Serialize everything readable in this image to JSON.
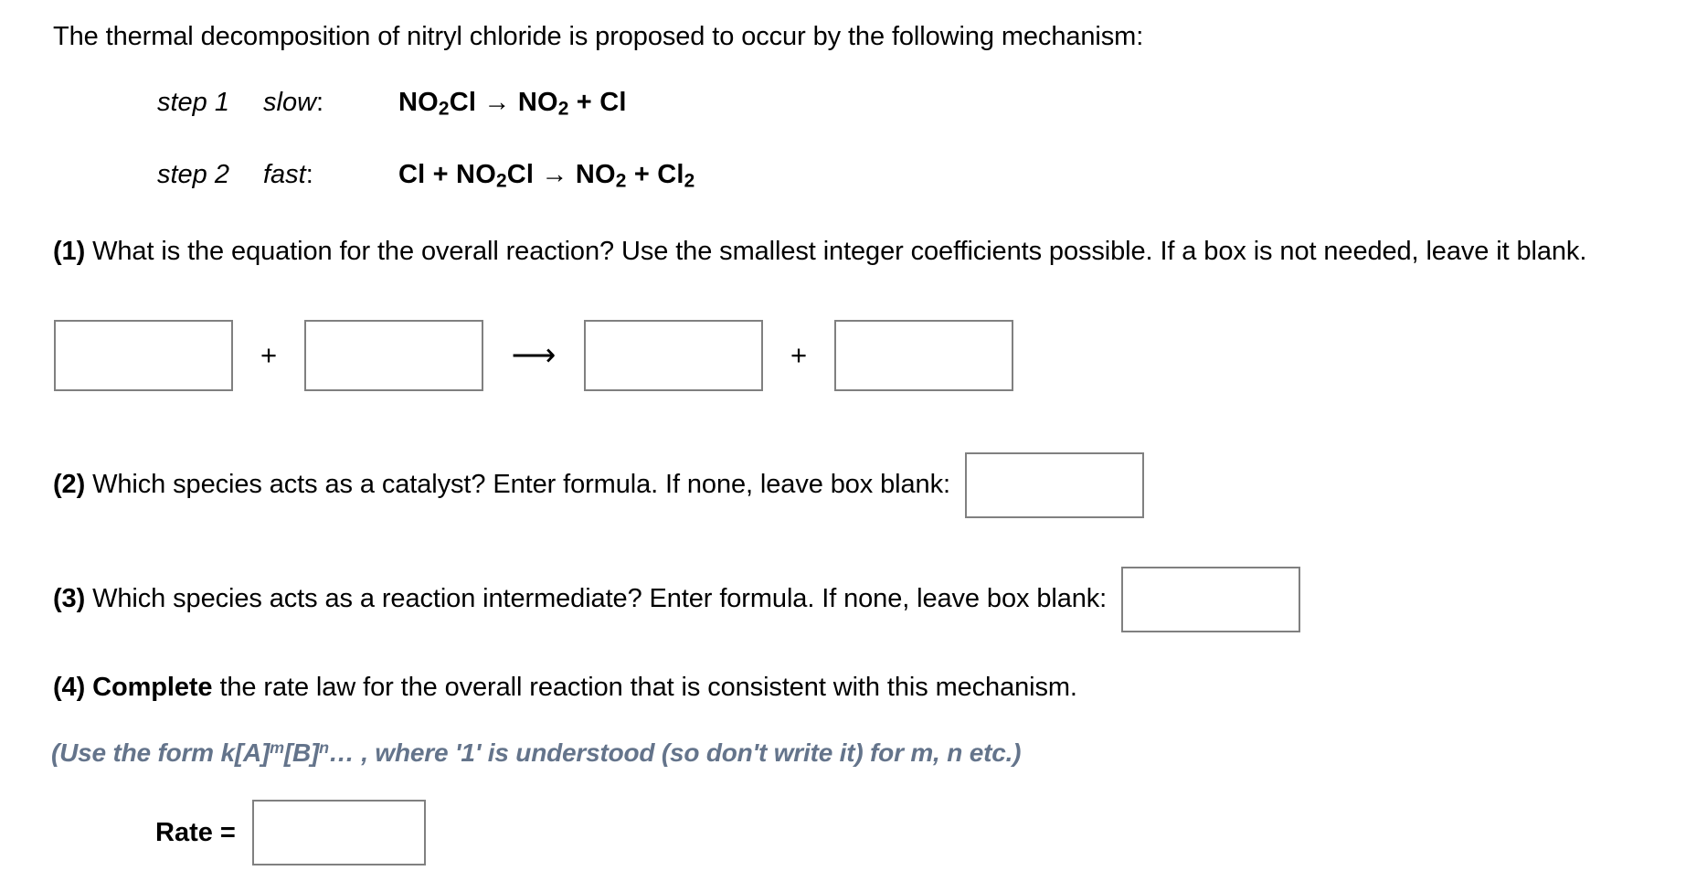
{
  "intro": {
    "text": "The thermal decomposition of nitryl chloride is proposed to occur by the following mechanism:"
  },
  "mechanism": {
    "steps": [
      {
        "label": "step 1",
        "speed": "slow",
        "colon": ":",
        "equation_plain": "NO2Cl → NO2 + Cl",
        "reactants": "NO2Cl",
        "products": "NO2 + Cl",
        "arrow": "→"
      },
      {
        "label": "step 2",
        "speed": "fast",
        "colon": ":",
        "equation_plain": "Cl + NO2Cl → NO2 + Cl2",
        "reactants": "Cl + NO2Cl",
        "products": "NO2 + Cl2",
        "arrow": "→"
      }
    ]
  },
  "questions": {
    "q1": {
      "number": "(1)",
      "text": "What is the equation for the overall reaction? Use the smallest integer coefficients possible. If a box is not needed, leave it blank.",
      "line1": "What is the equation for the overall reaction? Use the smallest integer coefficients possible. If a box is not",
      "line2": "needed, leave it blank.",
      "operators": {
        "plus": "+",
        "arrow": "⟶"
      },
      "boxes": [
        {
          "name": "reactant-1",
          "value": "",
          "placeholder": ""
        },
        {
          "name": "reactant-2",
          "value": "",
          "placeholder": ""
        },
        {
          "name": "product-1",
          "value": "",
          "placeholder": ""
        },
        {
          "name": "product-2",
          "value": "",
          "placeholder": ""
        }
      ]
    },
    "q2": {
      "number": "(2)",
      "text": "Which species acts as a catalyst? Enter formula. If none, leave box blank:",
      "box": {
        "value": "",
        "placeholder": ""
      }
    },
    "q3": {
      "number": "(3)",
      "text": "Which species acts as a reaction intermediate? Enter formula. If none, leave box blank:",
      "box": {
        "value": "",
        "placeholder": ""
      }
    },
    "q4": {
      "number": "(4)",
      "emphasis": "Complete",
      "text": "the rate law for the overall reaction that is consistent with this mechanism.",
      "hint_prefix": "(Use the form k[A]",
      "hint_sup_1": "m",
      "hint_mid": "[B]",
      "hint_sup_2": "n",
      "hint_suffix": "… , where '1' is understood (so don't write it) for m, n etc.)",
      "rate_label": "Rate =",
      "box": {
        "value": "",
        "placeholder": ""
      }
    }
  },
  "colors": {
    "text": "#000000",
    "hint": "#64748b",
    "box_border": "#808080",
    "background": "#ffffff"
  }
}
